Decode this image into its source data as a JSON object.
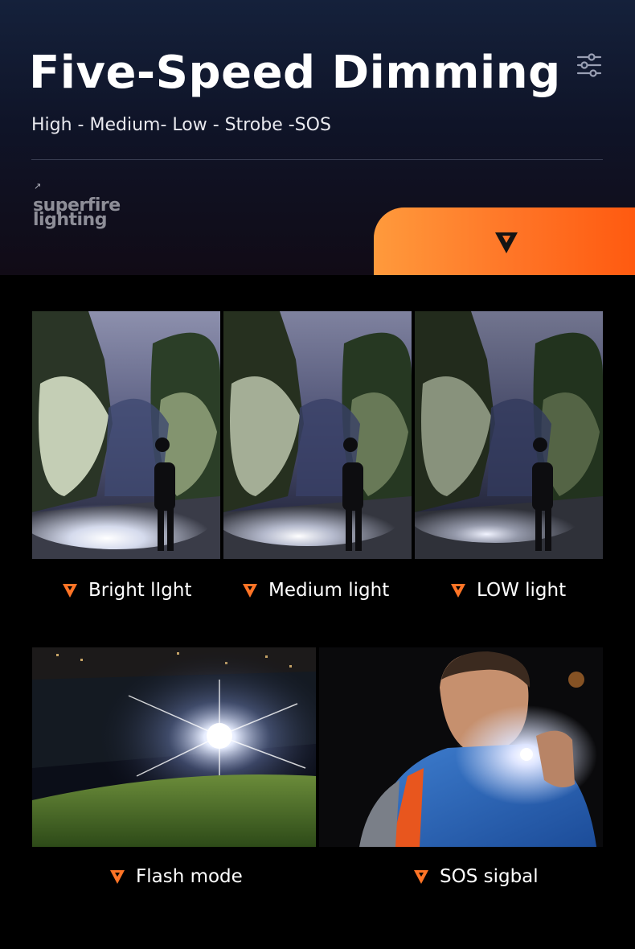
{
  "header": {
    "title": "Five-Speed Dimming",
    "subtitle": "High - Medium- Low - Strobe -SOS",
    "brand_line1": "superfire",
    "brand_line2": "lighting",
    "brand_arrow": "↗",
    "settings_icon": "sliders-icon",
    "tab_icon": "triangle-down-icon"
  },
  "colors": {
    "accent": "#ff7426",
    "header_top": "#15213b",
    "header_bottom": "#110b16",
    "background": "#000000"
  },
  "modes": [
    {
      "label": "Bright lIght",
      "icon": "triangle-down-icon"
    },
    {
      "label": "Medium light",
      "icon": "triangle-down-icon"
    },
    {
      "label": "LOW light",
      "icon": "triangle-down-icon"
    }
  ],
  "special_modes": [
    {
      "label": "Flash mode",
      "icon": "triangle-down-icon"
    },
    {
      "label": "SOS sigbal",
      "icon": "triangle-down-icon"
    }
  ]
}
